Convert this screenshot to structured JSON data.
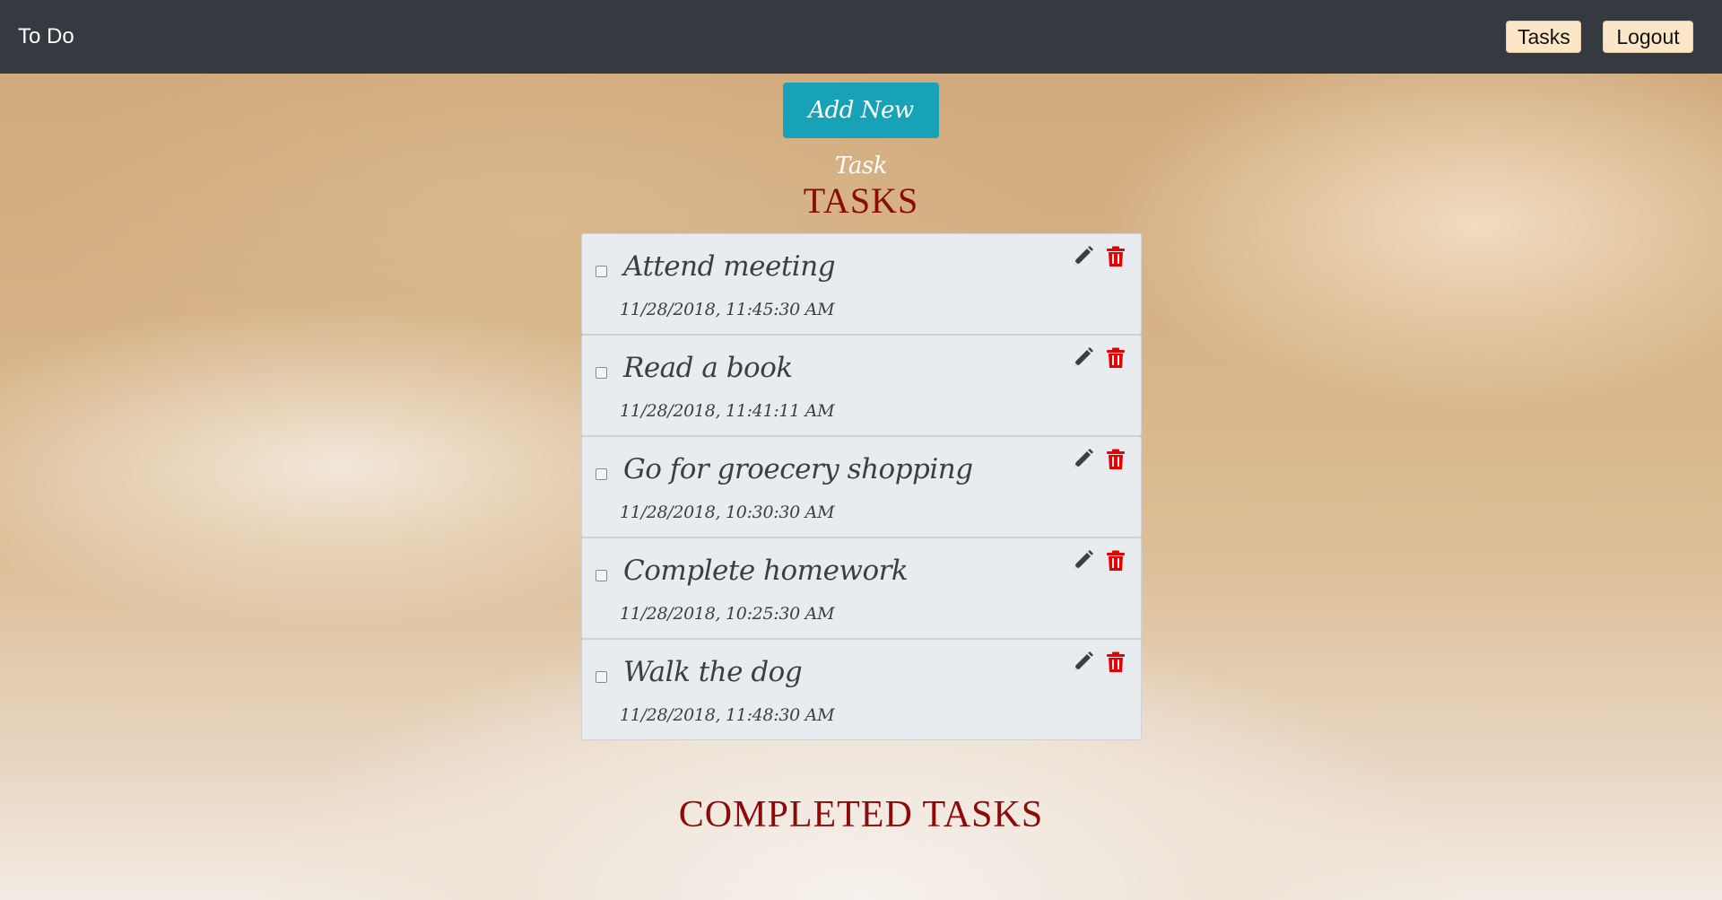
{
  "navbar": {
    "brand": "To Do",
    "tasks_label": "Tasks",
    "logout_label": "Logout"
  },
  "actions": {
    "add_task_label": "Add New Task"
  },
  "sections": {
    "tasks_heading": "TASKS",
    "completed_heading": "COMPLETED TASKS"
  },
  "tasks": [
    {
      "title": "Attend meeting",
      "date": "11/28/2018, 11:45:30 AM",
      "checked": false
    },
    {
      "title": "Read a book",
      "date": "11/28/2018, 11:41:11 AM",
      "checked": false
    },
    {
      "title": "Go for groecery shopping",
      "date": "11/28/2018, 10:30:30 AM",
      "checked": false
    },
    {
      "title": "Complete homework",
      "date": "11/28/2018, 10:25:30 AM",
      "checked": false
    },
    {
      "title": "Walk the dog",
      "date": "11/28/2018, 11:48:30 AM",
      "checked": false
    }
  ],
  "icons": {
    "edit": "pencil-icon",
    "delete": "trash-icon"
  },
  "colors": {
    "navbar": "#343a40",
    "nav_button": "#fde6c8",
    "add_button": "#17a2b8",
    "heading": "#8b0a0a",
    "delete_icon": "#e60000",
    "edit_icon": "#3a3f45",
    "task_card": "#e9ecef"
  }
}
